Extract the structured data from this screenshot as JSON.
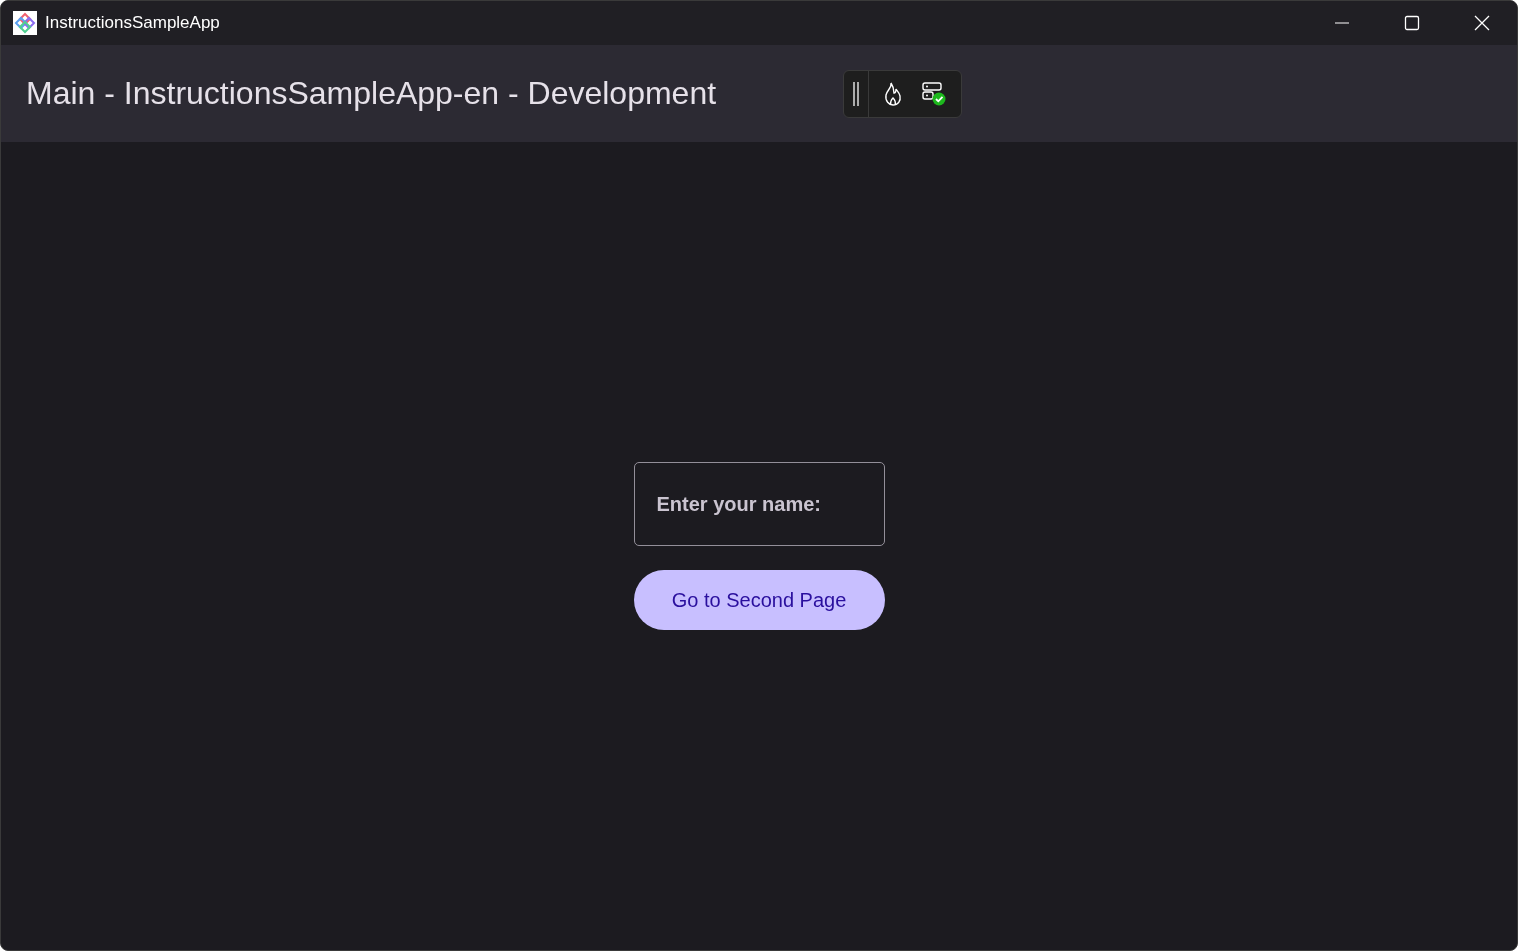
{
  "window": {
    "title": "InstructionsSampleApp"
  },
  "header": {
    "title": "Main - InstructionsSampleApp-en - Development"
  },
  "name_field": {
    "placeholder": "Enter your name:"
  },
  "button": {
    "label": "Go to Second Page"
  }
}
